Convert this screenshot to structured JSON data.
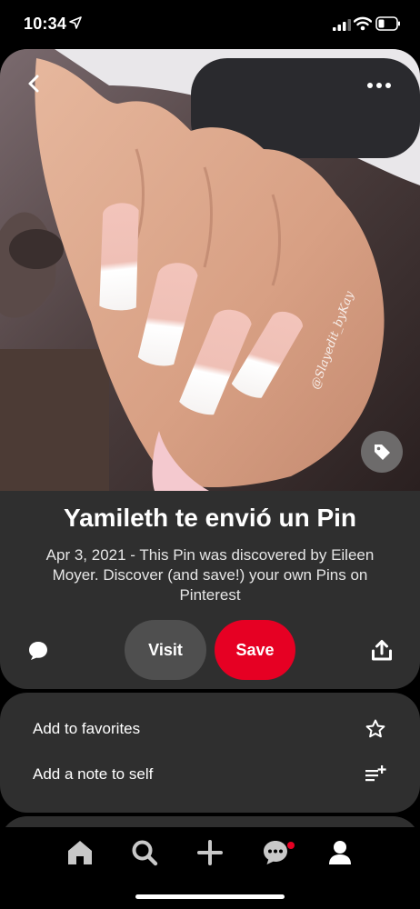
{
  "status_bar": {
    "time": "10:34"
  },
  "pin": {
    "title": "Yamileth te envió un Pin",
    "description": "Apr 3, 2021 - This Pin was discovered by Eileen Moyer. Discover (and save!) your own Pins on Pinterest",
    "visit_label": "Visit",
    "save_label": "Save",
    "image_watermark": "@Slayedit_byKay"
  },
  "options": [
    {
      "label": "Add to favorites",
      "icon": "star-outline-icon"
    },
    {
      "label": "Add a note to self",
      "icon": "note-add-icon"
    }
  ],
  "nav": [
    "home-icon",
    "search-icon",
    "create-icon",
    "messages-icon",
    "profile-icon"
  ],
  "colors": {
    "accent": "#e60023",
    "card": "#2f2f2f",
    "visit": "#4f4f4f"
  }
}
